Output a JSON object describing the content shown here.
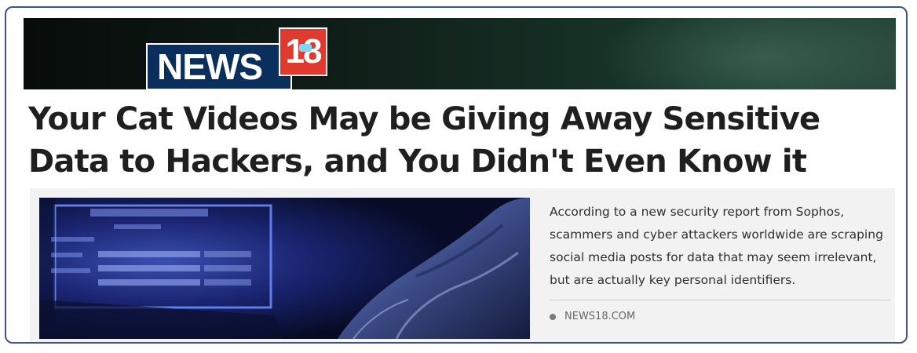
{
  "logo": {
    "word": "NEWS",
    "number": "18"
  },
  "headline": "Your Cat Videos May be Giving Away Sensitive Data to Hackers, and You Didn't Even Know it",
  "description": "According to a new security report from Sophos, scammers and cyber attackers worldwide are scraping social media posts for data that may seem irrelevant, but are actually key personal identifiers.",
  "source": "NEWS18.COM",
  "colors": {
    "border": "#3c5680",
    "logo_blue": "#0b2f5c",
    "logo_red": "#e03a2f",
    "preview_bg": "#f2f2f2"
  },
  "icons": {
    "source_dot": "bullet-dot-icon",
    "thumbnail": "hacker-glove-laptop-image"
  }
}
